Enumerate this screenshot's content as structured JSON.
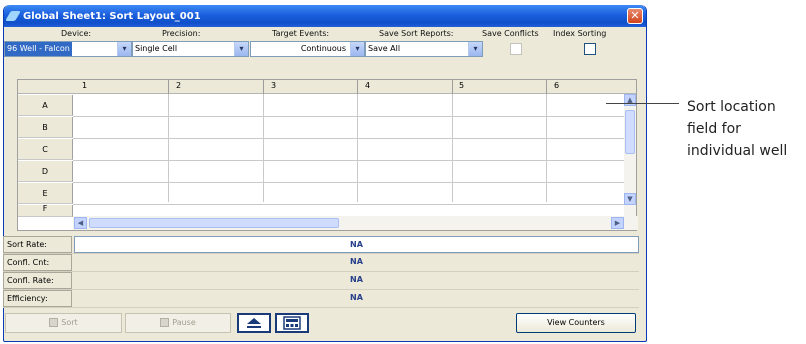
{
  "window": {
    "title": "Global Sheet1: Sort Layout_001",
    "close_glyph": "✕"
  },
  "settings": {
    "device": {
      "label": "Device:",
      "value": "96 Well - Falcon"
    },
    "precision": {
      "label": "Precision:",
      "value": "Single Cell"
    },
    "target_events": {
      "label": "Target Events:",
      "value": "Continuous"
    },
    "save_sort_reports": {
      "label": "Save Sort Reports:",
      "value": "Save All"
    },
    "save_conflicts": {
      "label": "Save Conflicts",
      "checked": false,
      "enabled": false
    },
    "index_sorting": {
      "label": "Index Sorting",
      "checked": false,
      "enabled": true
    }
  },
  "grid": {
    "columns": [
      "1",
      "2",
      "3",
      "4",
      "5",
      "6"
    ],
    "rows": [
      "A",
      "B",
      "C",
      "D",
      "E",
      "F"
    ]
  },
  "stats": [
    {
      "label": "Sort Rate:",
      "value": "NA"
    },
    {
      "label": "Confl. Cnt:",
      "value": "NA"
    },
    {
      "label": "Confl. Rate:",
      "value": "NA"
    },
    {
      "label": "Efficiency:",
      "value": "NA"
    }
  ],
  "toolbar": {
    "sort_label": "Sort",
    "pause_label": "Pause",
    "view_counters_label": "View Counters",
    "eject_icon": "eject-icon",
    "counter_icon": "counter-icon"
  },
  "annotation": {
    "text": "Sort location field for individual well"
  },
  "colors": {
    "titlebar": "#0f4fc9",
    "window_bg": "#ece9d8",
    "na_text": "#27408b"
  }
}
